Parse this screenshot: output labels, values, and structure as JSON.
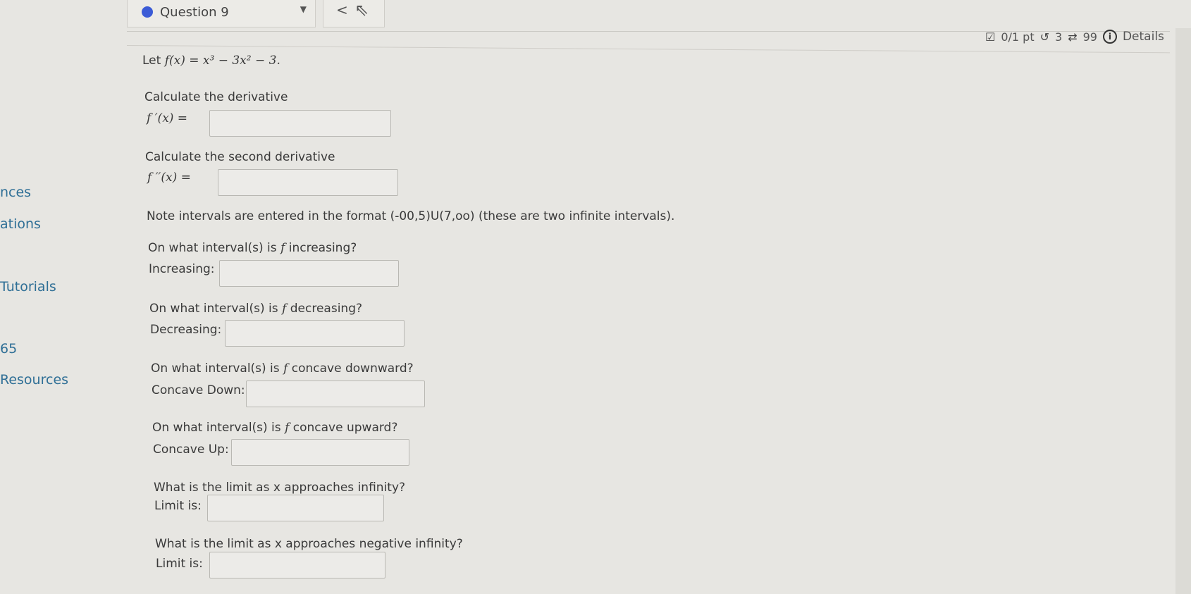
{
  "sidebar": {
    "items": [
      "nces",
      "ations",
      "Tutorials",
      "65",
      "Resources"
    ]
  },
  "header": {
    "question_label": "Question 9",
    "caret": "▼",
    "prev": "<"
  },
  "meta": {
    "score": "0/1 pt",
    "retries": "3",
    "submissions": "99",
    "details": "Details"
  },
  "problem": {
    "let": "Let",
    "function_def": "f(x) = x³ − 3x² − 3.",
    "deriv_prompt": "Calculate the derivative",
    "deriv_label": "f ′(x) =",
    "second_deriv_prompt": "Calculate the second derivative",
    "second_deriv_label": "f ′′(x) =",
    "note": "Note intervals are entered in the format (-00,5)U(7,oo) (these are two infinite intervals).",
    "inc_prompt_a": "On what interval(s) is",
    "inc_prompt_b": "increasing?",
    "inc_label": "Increasing:",
    "dec_prompt_a": "On what interval(s) is",
    "dec_prompt_b": "decreasing?",
    "dec_label": "Decreasing:",
    "cd_prompt_a": "On what interval(s) is",
    "cd_prompt_b": "concave downward?",
    "cd_label": "Concave Down:",
    "cu_prompt_a": "On what interval(s) is",
    "cu_prompt_b": "concave upward?",
    "cu_label": "Concave Up:",
    "lim_pos_prompt": "What is the limit as x approaches infinity?",
    "lim_pos_label": "Limit is:",
    "lim_neg_prompt": "What is the limit as x approaches negative infinity?",
    "lim_neg_label": "Limit is:",
    "f_symbol": "f"
  }
}
